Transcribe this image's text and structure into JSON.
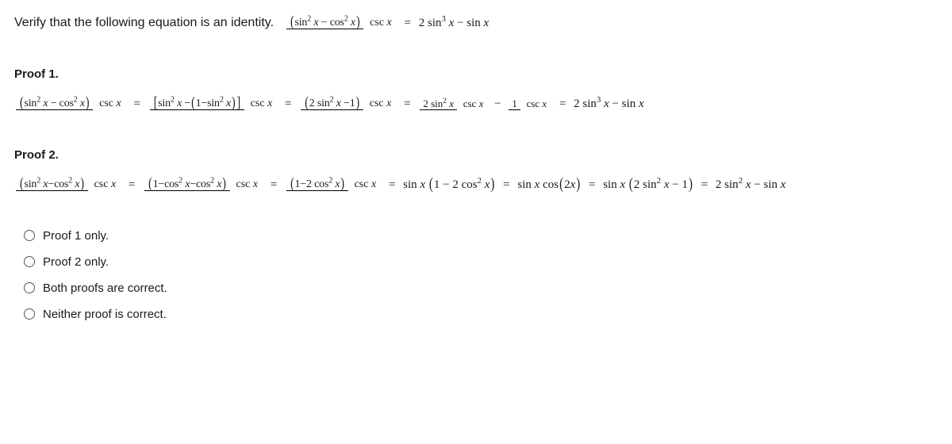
{
  "prompt": "Verify that the following equation is an identity.",
  "identity": {
    "lhs_num": "(sin² x − cos² x)",
    "lhs_den": "csc x",
    "rhs": "2 sin³ x − sin x"
  },
  "proof1": {
    "title": "Proof 1.",
    "s1_num": "(sin² x − cos² x)",
    "s1_den": "csc x",
    "s2_num": "[sin² x −(1−sin² x)]",
    "s2_den": "csc x",
    "s3_num": "(2 sin² x −1)",
    "s3_den": "csc x",
    "s4_num": "2 sin² x",
    "s4_den": "csc x",
    "s5_num": "1",
    "s5_den": "csc x",
    "s6": "2 sin³ x − sin x"
  },
  "proof2": {
    "title": "Proof 2.",
    "s1_num": "(sin² x−cos² x)",
    "s1_den": "csc x",
    "s2_num": "(1−cos² x−cos² x)",
    "s2_den": "csc x",
    "s3_num": "(1−2 cos² x)",
    "s3_den": "csc x",
    "s4": "sin x (1 − 2 cos² x)",
    "s5": "sin x  cos(2x)",
    "s6": "sin x (2 sin² x − 1)",
    "s7": "2 sin² x − sin x"
  },
  "options": [
    "Proof 1 only.",
    "Proof 2 only.",
    "Both proofs are correct.",
    "Neither proof is correct."
  ]
}
